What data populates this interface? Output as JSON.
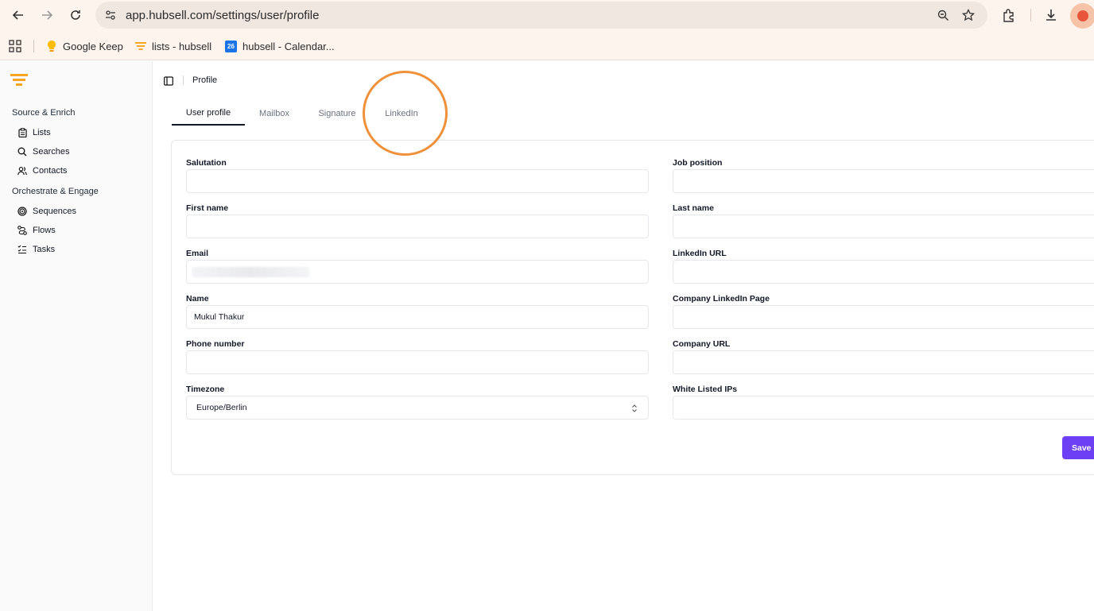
{
  "browser": {
    "url": "app.hubsell.com/settings/user/profile",
    "bookmarks": [
      {
        "label": "Google Keep"
      },
      {
        "label": "lists - hubsell"
      },
      {
        "label": "hubsell - Calendar..."
      }
    ],
    "calendar_badge": "26"
  },
  "sidebar": {
    "sections": [
      {
        "label": "Source & Enrich",
        "items": [
          {
            "label": "Lists",
            "icon": "clipboard-icon"
          },
          {
            "label": "Searches",
            "icon": "search-icon"
          },
          {
            "label": "Contacts",
            "icon": "users-icon"
          }
        ]
      },
      {
        "label": "Orchestrate & Engage",
        "items": [
          {
            "label": "Sequences",
            "icon": "target-icon"
          },
          {
            "label": "Flows",
            "icon": "flow-icon"
          },
          {
            "label": "Tasks",
            "icon": "tasks-icon"
          }
        ]
      }
    ]
  },
  "header": {
    "breadcrumb": "Profile"
  },
  "tabs": [
    {
      "label": "User profile",
      "active": true
    },
    {
      "label": "Mailbox",
      "active": false
    },
    {
      "label": "Signature",
      "active": false
    },
    {
      "label": "LinkedIn",
      "active": false
    }
  ],
  "form": {
    "left": [
      {
        "label": "Salutation",
        "value": ""
      },
      {
        "label": "First name",
        "value": ""
      },
      {
        "label": "Email",
        "value": ""
      },
      {
        "label": "Name",
        "value": "Mukul Thakur"
      },
      {
        "label": "Phone number",
        "value": ""
      },
      {
        "label": "Timezone",
        "value": "Europe/Berlin"
      }
    ],
    "right": [
      {
        "label": "Job position",
        "value": ""
      },
      {
        "label": "Last name",
        "value": ""
      },
      {
        "label": "LinkedIn URL",
        "value": ""
      },
      {
        "label": "Company LinkedIn Page",
        "value": ""
      },
      {
        "label": "Company URL",
        "value": ""
      },
      {
        "label": "White Listed IPs",
        "value": ""
      }
    ],
    "save_label": "Save changes"
  },
  "colors": {
    "accent": "#6d3ff5",
    "highlight": "#f0913a",
    "brand": "#f5a623"
  }
}
